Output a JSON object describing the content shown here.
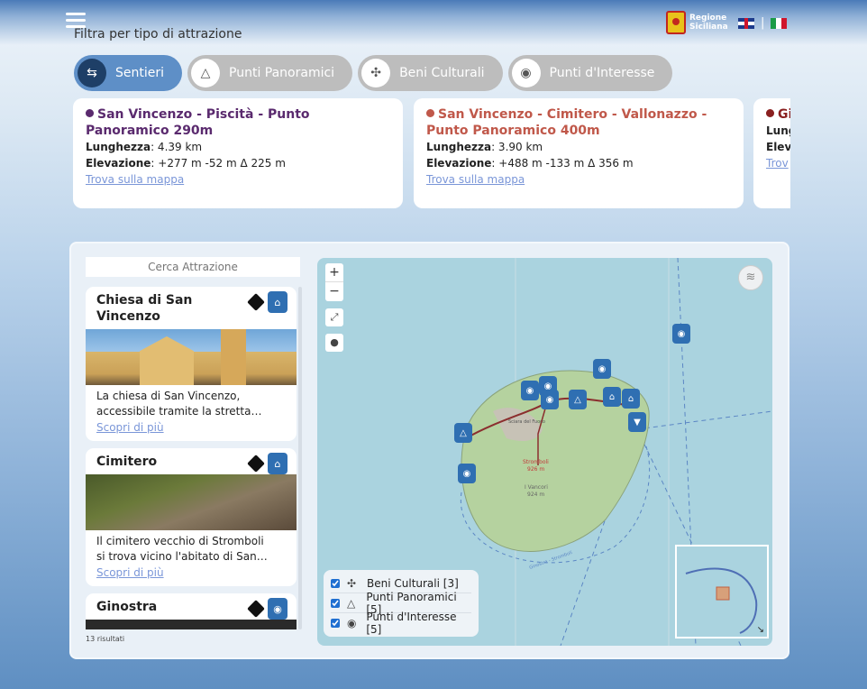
{
  "header": {
    "filter_title": "Filtra per tipo di attrazione",
    "logo_line1": "Regione",
    "logo_line2": "Siciliana",
    "lang_separator": "|"
  },
  "filters": [
    {
      "label": "Sentieri",
      "icon": "signpost-icon",
      "active": true
    },
    {
      "label": "Punti Panoramici",
      "icon": "mountain-icon",
      "active": false
    },
    {
      "label": "Beni Culturali",
      "icon": "trinacria-icon",
      "active": false
    },
    {
      "label": "Punti d'Interesse",
      "icon": "person-pin-icon",
      "active": false
    }
  ],
  "trails": [
    {
      "title": "San Vincenzo - Piscità - Punto Panoramico 290m",
      "color": "#5a2a6e",
      "length_label": "Lunghezza",
      "length_value": ": 4.39 km",
      "elev_label": "Elevazione",
      "elev_value": ": +277 m -52 m Δ 225 m",
      "link": "Trova sulla mappa"
    },
    {
      "title": "San Vincenzo - Cimitero - Vallonazzo - Punto Panoramico 400m",
      "color": "#c0584a",
      "length_label": "Lunghezza",
      "length_value": ": 3.90 km",
      "elev_label": "Elevazione",
      "elev_value": ": +488 m -133 m Δ 356 m",
      "link": "Trova sulla mappa"
    },
    {
      "title": "Gi",
      "color": "#8a2020",
      "length_label": "Lung",
      "elev_label": "Elev",
      "link": "Trov"
    }
  ],
  "search": {
    "placeholder": "Cerca Attrazione"
  },
  "attractions": [
    {
      "title": "Chiesa di San Vincenzo",
      "desc_line1": "La chiesa di San Vincenzo,",
      "desc_line2": "accessibile tramite la stretta…",
      "link": "Scopri di più"
    },
    {
      "title": "Cimitero",
      "desc_line1": "Il cimitero vecchio di Stromboli",
      "desc_line2": "si trova vicino l'abitato di San…",
      "link": "Scopri di più"
    },
    {
      "title": "Ginostra"
    }
  ],
  "results_count": "13 risultati",
  "map": {
    "zoom_in": "+",
    "zoom_out": "−",
    "label_scari": "Sciara del Fuoco",
    "label_peak1": "Stromboli",
    "label_peak1_elev": "926 m",
    "label_peak2": "I Vancori",
    "label_peak2_elev": "924 m",
    "label_route": "Ginostra - Stromboli",
    "legend": [
      {
        "label": "Beni Culturali [3]",
        "icon": "trinacria-icon",
        "checked": true
      },
      {
        "label": "Punti Panoramici [5]",
        "icon": "mountain-icon",
        "checked": true
      },
      {
        "label": "Punti d'Interesse [5]",
        "icon": "person-pin-icon",
        "checked": true
      }
    ]
  }
}
